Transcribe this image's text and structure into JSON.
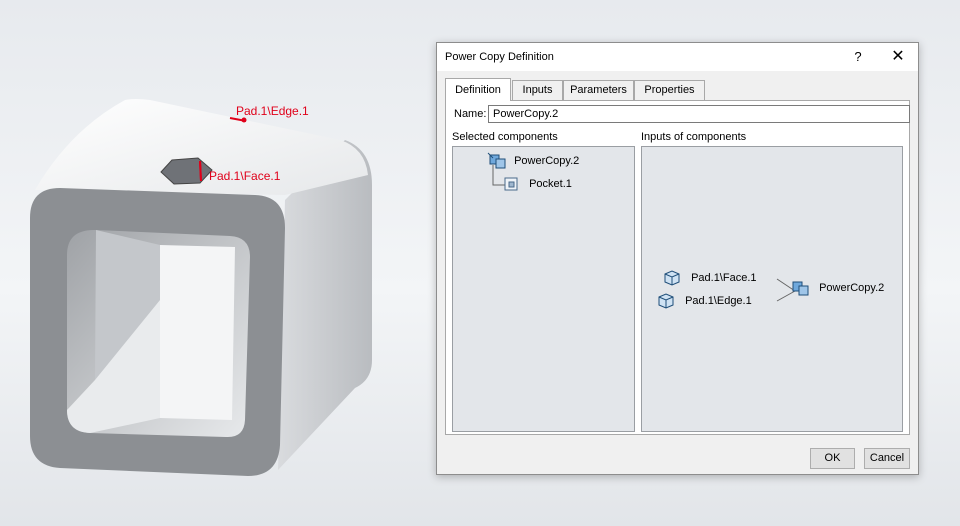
{
  "viewport": {
    "annotations": {
      "edge": "Pad.1\\Edge.1",
      "face": "Pad.1\\Face.1"
    }
  },
  "dialog": {
    "title": "Power Copy Definition",
    "help_label": "?",
    "close_label": "✕",
    "tabs": [
      {
        "label": "Definition",
        "active": true
      },
      {
        "label": "Inputs"
      },
      {
        "label": "Parameters"
      },
      {
        "label": "Properties"
      }
    ],
    "name_label": "Name:",
    "name_value": "PowerCopy.2",
    "selected_components": {
      "label": "Selected components",
      "items": [
        "PowerCopy.2",
        "Pocket.1"
      ]
    },
    "inputs_of_components": {
      "label": "Inputs of components",
      "inputs": [
        "Pad.1\\Face.1",
        "Pad.1\\Edge.1"
      ],
      "target": "PowerCopy.2"
    },
    "ok_label": "OK",
    "cancel_label": "Cancel"
  }
}
